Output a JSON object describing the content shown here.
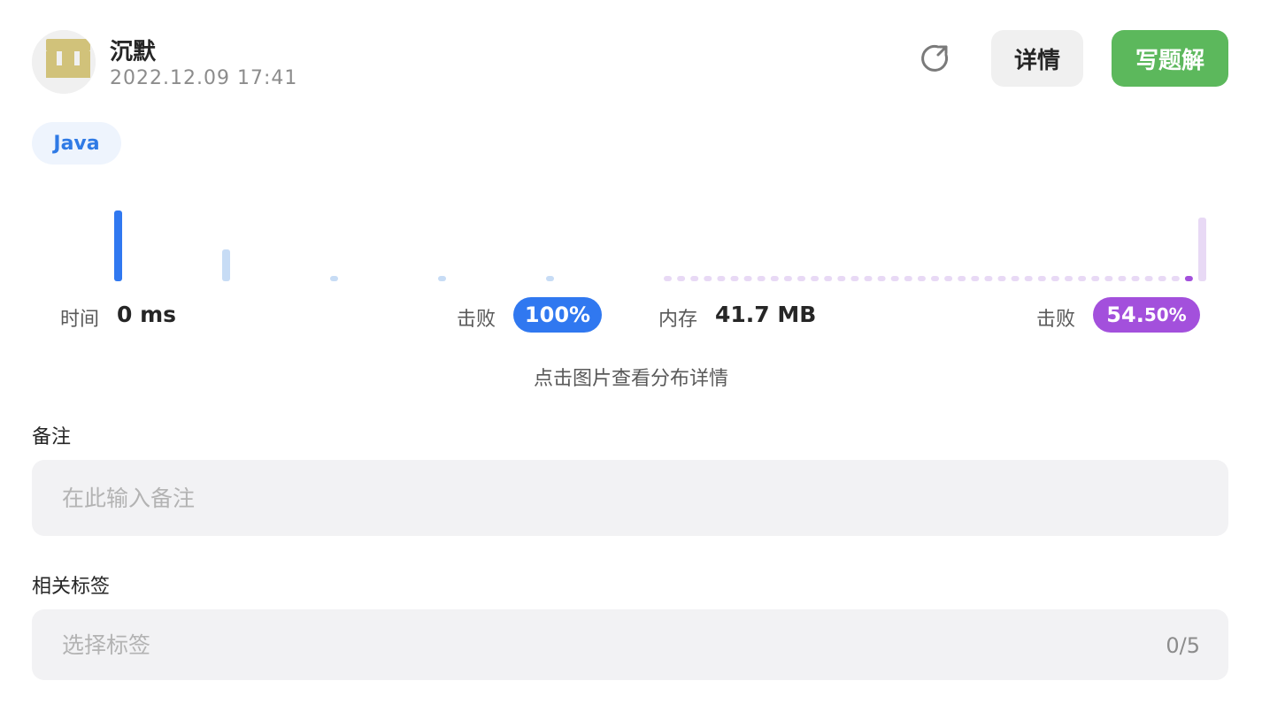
{
  "header": {
    "user_name": "沉默",
    "submit_time": "2022.12.09 17:41",
    "detail_label": "详情",
    "write_solution_label": "写题解"
  },
  "language_tag": "Java",
  "runtime": {
    "label": "时间",
    "value": "0 ms",
    "beat_label": "击败",
    "beat_percent": "100%"
  },
  "memory": {
    "label": "内存",
    "value": "41.7 MB",
    "beat_label": "击败",
    "beat_percent_main": "54.",
    "beat_percent_decimal": "50%"
  },
  "chart_hint": "点击图片查看分布详情",
  "note": {
    "label": "备注",
    "placeholder": "在此输入备注"
  },
  "tags": {
    "label": "相关标签",
    "placeholder": "选择标签",
    "count": "0/5"
  },
  "colors": {
    "runtime_active": "#3078f0",
    "runtime_bar": "#c7dcf5",
    "memory_active": "#a350dc",
    "memory_bar": "#e8d9f5",
    "primary_green": "#5cb85c"
  },
  "chart_data": {
    "type": "bar",
    "charts": [
      {
        "name": "runtime",
        "bins": 5,
        "values": [
          100,
          45,
          4,
          4,
          4
        ],
        "highlight_index": 0
      },
      {
        "name": "memory",
        "bins": 41,
        "values": [
          4,
          4,
          4,
          4,
          4,
          4,
          4,
          4,
          4,
          4,
          4,
          4,
          4,
          4,
          4,
          4,
          4,
          4,
          4,
          4,
          4,
          4,
          4,
          4,
          4,
          4,
          4,
          4,
          4,
          4,
          4,
          4,
          4,
          4,
          4,
          4,
          4,
          4,
          4,
          4,
          90
        ],
        "highlight_index": 39
      }
    ]
  }
}
